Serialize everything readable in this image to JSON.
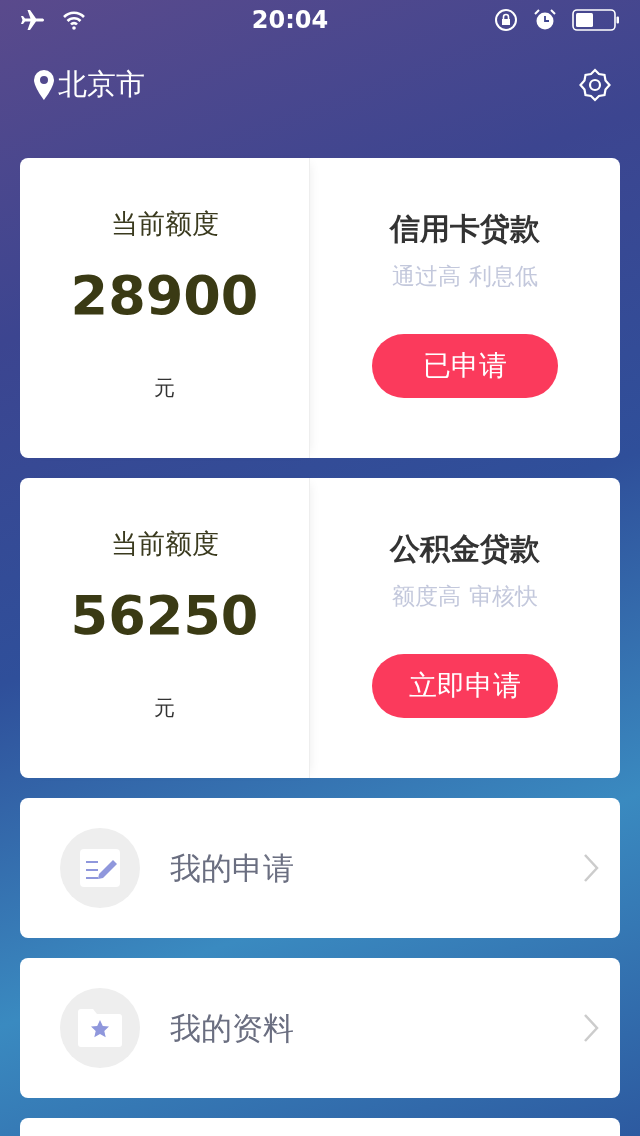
{
  "status_bar": {
    "time": "20:04"
  },
  "header": {
    "city": "北京市"
  },
  "loans": [
    {
      "limit_label": "当前额度",
      "amount": "28900",
      "unit": "元",
      "title": "信用卡贷款",
      "subtitle": "通过高 利息低",
      "button": "已申请"
    },
    {
      "limit_label": "当前额度",
      "amount": "56250",
      "unit": "元",
      "title": "公积金贷款",
      "subtitle": "额度高 审核快",
      "button": "立即申请"
    }
  ],
  "menu": [
    {
      "kind": "edit",
      "label": "我的申请"
    },
    {
      "kind": "folder",
      "label": "我的资料"
    }
  ]
}
